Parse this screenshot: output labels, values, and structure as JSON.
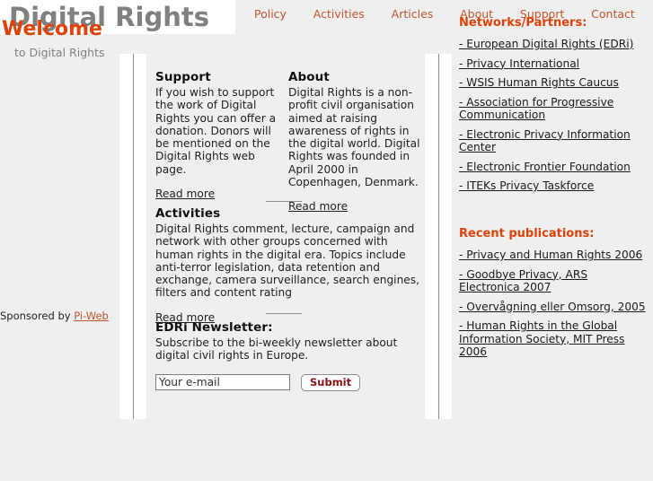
{
  "site": {
    "logo": "Digital Rights",
    "accent_orange": "#e04106",
    "nav_orange": "#c1562c",
    "logo_gray": "#808080",
    "background": "#efefef"
  },
  "nav": {
    "items": [
      {
        "label": "Policy"
      },
      {
        "label": "Activities"
      },
      {
        "label": "Articles"
      },
      {
        "label": "About"
      },
      {
        "label": "Support"
      },
      {
        "label": "Contact"
      }
    ]
  },
  "sidebar_left": {
    "welcome_title": "Welcome",
    "welcome_subtitle": "to Digital Rights",
    "sponsor_prefix": "Sponsored by ",
    "sponsor_link": "Pi-Web"
  },
  "main": {
    "support": {
      "heading": "Support",
      "body": "If you wish to support the work of Digital Rights you can offer a donation. Donors will be mentioned on the Digital Rights web page.",
      "read_more": "Read more"
    },
    "about": {
      "heading": "About",
      "body": "Digital Rights is a non-profit civil organisation aimed at raising awareness of rights in the digital world. Digital Rights was founded in April 2000 in Copenhagen, Denmark.",
      "read_more": "Read more"
    },
    "activities": {
      "heading": "Activities",
      "body": "Digital Rights comment, lecture, campaign and network with other groups concerned with human rights in the digital era. Topics include anti-terror legislation, data retention and exchange, camera surveillance, search engines, filters and content rating",
      "read_more": "Read more"
    },
    "newsletter": {
      "heading": "EDRi Newsletter:",
      "body": "Subscribe to the bi-weekly newsletter about digital civil rights in Europe.",
      "email_value": "Your e-mail",
      "email_placeholder": "Your e-mail",
      "submit_label": "Submit"
    }
  },
  "sidebar_right": {
    "networks": {
      "heading": "Networks/Partners:",
      "links": [
        "- European Digital Rights (EDRi)",
        "- Privacy International",
        "- WSIS Human Rights Caucus",
        "- Association for Progressive Communication",
        "- Electronic Privacy Information Center",
        "- Electronic Frontier Foundation",
        "- ITEKs Privacy Taskforce"
      ]
    },
    "publications": {
      "heading": "Recent publications:",
      "links": [
        "- Privacy and Human Rights 2006",
        "- Goodbye Privacy, ARS Electronica 2007",
        "- Overvågning eller Omsorg, 2005",
        "- Human Rights in the Global Information Society, MIT Press 2006"
      ]
    }
  }
}
